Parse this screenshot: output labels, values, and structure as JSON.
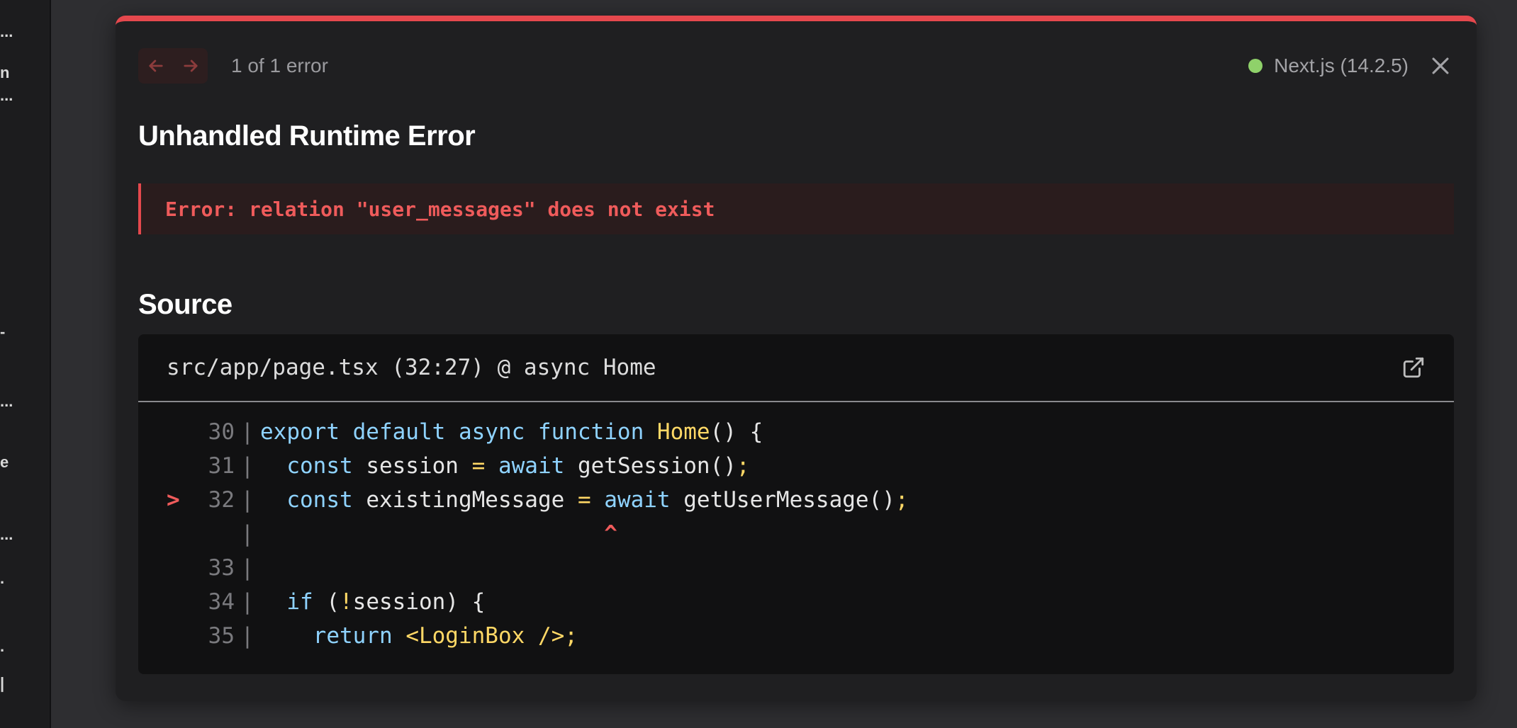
{
  "sidebar_fragments": [
    "...",
    "n",
    "...",
    "-",
    "...",
    "e",
    "...",
    ".",
    ".",
    "|"
  ],
  "colors": {
    "accent_red": "#e5484d",
    "status_green": "#8fd16a",
    "keyword_blue": "#8fd3ff",
    "function_yellow": "#ffd866"
  },
  "nav": {
    "prev_icon": "arrow-left-icon",
    "next_icon": "arrow-right-icon",
    "counter": "1 of 1 error"
  },
  "version": {
    "label": "Next.js (14.2.5)"
  },
  "close_icon": "close-icon",
  "title": "Unhandled Runtime Error",
  "error_message": "Error: relation \"user_messages\" does not exist",
  "source": {
    "heading": "Source",
    "file_ref": "src/app/page.tsx (32:27) @ async Home",
    "open_icon": "external-link-icon",
    "lines": [
      {
        "num": "30",
        "marker": "",
        "tokens": [
          {
            "t": "kw",
            "v": "export default async function "
          },
          {
            "t": "fn",
            "v": "Home"
          },
          {
            "t": "plain",
            "v": "() {"
          }
        ]
      },
      {
        "num": "31",
        "marker": "",
        "tokens": [
          {
            "t": "plain",
            "v": "  "
          },
          {
            "t": "kw",
            "v": "const "
          },
          {
            "t": "plain",
            "v": "session "
          },
          {
            "t": "op",
            "v": "="
          },
          {
            "t": "plain",
            "v": " "
          },
          {
            "t": "kw",
            "v": "await "
          },
          {
            "t": "plain",
            "v": "getSession()"
          },
          {
            "t": "op",
            "v": ";"
          }
        ]
      },
      {
        "num": "32",
        "marker": ">",
        "tokens": [
          {
            "t": "plain",
            "v": "  "
          },
          {
            "t": "kw",
            "v": "const "
          },
          {
            "t": "plain",
            "v": "existingMessage "
          },
          {
            "t": "op",
            "v": "="
          },
          {
            "t": "plain",
            "v": " "
          },
          {
            "t": "kw",
            "v": "await "
          },
          {
            "t": "plain",
            "v": "getUserMessage()"
          },
          {
            "t": "op",
            "v": ";"
          }
        ]
      },
      {
        "num": "",
        "marker": "",
        "tokens": [
          {
            "t": "caret",
            "v": "                          ^"
          }
        ]
      },
      {
        "num": "33",
        "marker": "",
        "tokens": []
      },
      {
        "num": "34",
        "marker": "",
        "tokens": [
          {
            "t": "plain",
            "v": "  "
          },
          {
            "t": "kw",
            "v": "if "
          },
          {
            "t": "plain",
            "v": "("
          },
          {
            "t": "op",
            "v": "!"
          },
          {
            "t": "plain",
            "v": "session) {"
          }
        ]
      },
      {
        "num": "35",
        "marker": "",
        "tokens": [
          {
            "t": "plain",
            "v": "    "
          },
          {
            "t": "kw",
            "v": "return "
          },
          {
            "t": "fn",
            "v": "<LoginBox />"
          },
          {
            "t": "op",
            "v": ";"
          }
        ]
      }
    ]
  }
}
